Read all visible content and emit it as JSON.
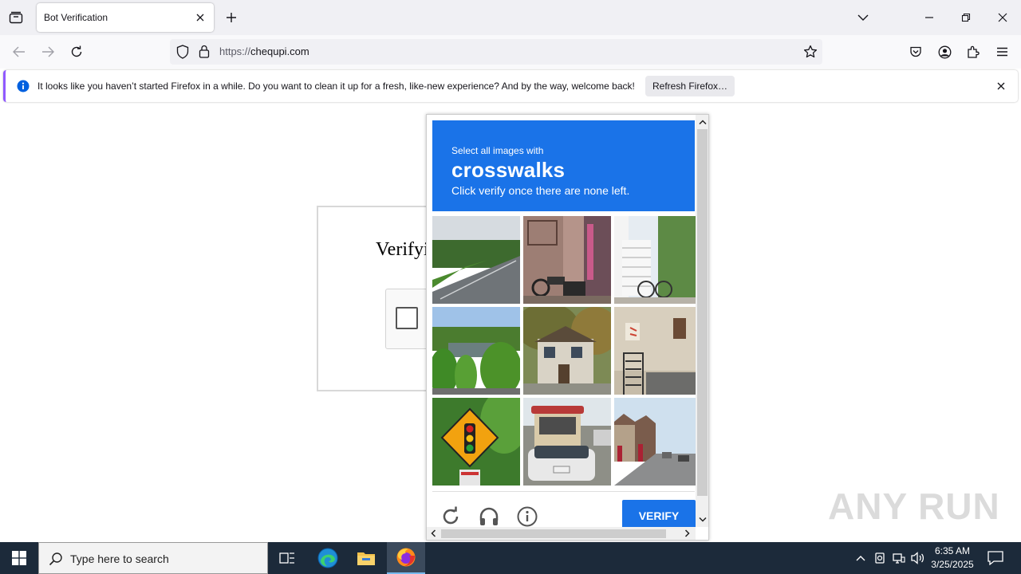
{
  "browser": {
    "tab_title": "Bot Verification",
    "url_prefix": "https://",
    "url_domain": "chequpi.com"
  },
  "notification": {
    "message": "It looks like you haven’t started Firefox in a while. Do you want to clean it up for a fresh, like-new experience? And by the way, welcome back!",
    "button_label": "Refresh Firefox…"
  },
  "page": {
    "heading": "Verifyi"
  },
  "challenge": {
    "instruction": "Select all images with",
    "target": "crosswalks",
    "subtext": "Click verify once there are none left.",
    "verify_label": "VERIFY",
    "tiles": [
      {
        "description": "highway-road"
      },
      {
        "description": "motorcycle-doorway"
      },
      {
        "description": "bicycle-railing"
      },
      {
        "description": "trees-pond"
      },
      {
        "description": "house-trees"
      },
      {
        "description": "building-stairs"
      },
      {
        "description": "traffic-light-sign"
      },
      {
        "description": "vehicles-street"
      },
      {
        "description": "street-buildings"
      }
    ]
  },
  "watermark": "ANY RUN",
  "taskbar": {
    "search_placeholder": "Type here to search",
    "time": "6:35 AM",
    "date": "3/25/2025"
  },
  "colors": {
    "accent": "#1a73e8",
    "taskbar": "#1c2a3a",
    "notification_stripe": "#9059ff"
  }
}
